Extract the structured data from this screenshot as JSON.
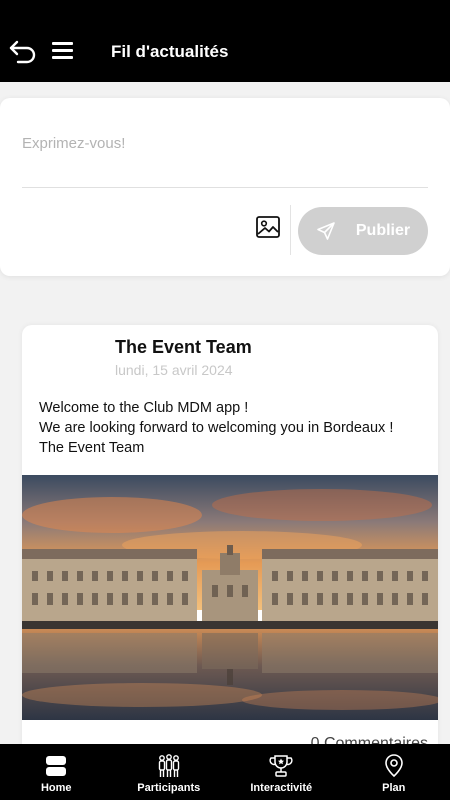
{
  "header": {
    "title": "Fil d'actualités",
    "back_icon": "back-arrow-icon",
    "menu_icon": "hamburger-menu-icon"
  },
  "compose": {
    "placeholder": "Exprimez-vous!",
    "image_icon": "image-icon",
    "publish_icon": "send-icon",
    "publish_label": "Publier"
  },
  "post": {
    "author": "The Event Team",
    "date": "lundi, 15 avril 2024",
    "body_lines": [
      "Welcome to the Club MDM app !",
      "We are looking forward to welcoming you in Bordeaux !",
      "The Event Team"
    ],
    "comments": "0 Commentaires"
  },
  "nav": {
    "items": [
      {
        "label": "Home",
        "icon": "home-icon"
      },
      {
        "label": "Participants",
        "icon": "participants-icon"
      },
      {
        "label": "Interactivité",
        "icon": "trophy-icon"
      },
      {
        "label": "Plan",
        "icon": "map-pin-icon"
      }
    ]
  },
  "colors": {
    "header_bg": "#000000",
    "publish_bg": "#d0d0d0",
    "nav_bg": "#000000"
  }
}
